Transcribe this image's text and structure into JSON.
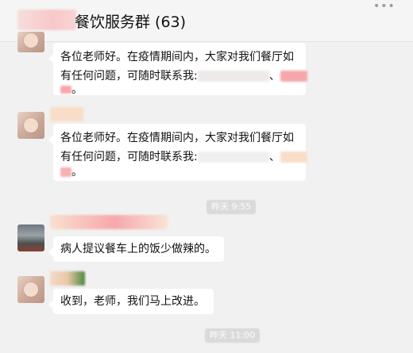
{
  "header": {
    "title": "餐饮服务群 (63)",
    "more_icon": "•••"
  },
  "messages": [
    {
      "line1": "各位老师好。在疫情期间内，大家对我们餐厅如",
      "line2": "有任何问题，可随时联系我:",
      "sep": "、",
      "end": "。"
    },
    {
      "line1": "各位老师好。在疫情期间内，大家对我们餐厅如",
      "line2": "有任何问题，可随时联系我:",
      "sep": "、",
      "end": "。"
    },
    {
      "text": "病人提议餐车上的饭少做辣的。"
    },
    {
      "text": "收到，老师，我们马上改进。"
    }
  ],
  "timestamps": [
    "昨天 9:55",
    "昨天 11:00"
  ],
  "colors": {
    "background": "#f1f1f1",
    "bubble": "#ffffff",
    "redaction_pink": "#f7a7ab",
    "redaction_peach": "#f9ddc9"
  }
}
